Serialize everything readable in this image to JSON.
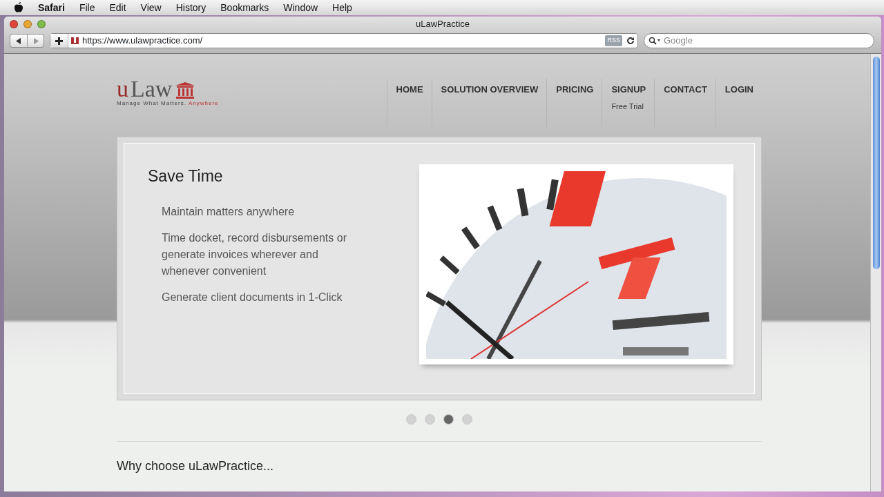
{
  "menu_bar": {
    "app": "Safari",
    "items": [
      "File",
      "Edit",
      "View",
      "History",
      "Bookmarks",
      "Window",
      "Help"
    ]
  },
  "window": {
    "title": "uLawPractice"
  },
  "toolbar": {
    "url": "https://www.ulawpractice.com/",
    "rss": "RSS",
    "search_placeholder": "Google"
  },
  "site": {
    "logo": {
      "word_u": "u",
      "word_rest": "Law",
      "tagline": "Manage What Matters.",
      "tagline_accent": "Anywhere"
    },
    "nav": [
      {
        "label": "HOME"
      },
      {
        "label": "SOLUTION OVERVIEW"
      },
      {
        "label": "PRICING"
      },
      {
        "label": "SIGNUP",
        "sub": "Free Trial"
      },
      {
        "label": "CONTACT"
      },
      {
        "label": "LOGIN"
      }
    ],
    "slide": {
      "title": "Save Time",
      "points": [
        "Maintain matters anywhere",
        "Time docket, record disbursements or generate invoices wherever and whenever convenient",
        "Generate client documents in 1-Click"
      ]
    },
    "dots": [
      {
        "selected": false
      },
      {
        "selected": false
      },
      {
        "selected": true
      },
      {
        "selected": false
      }
    ],
    "section_heading": "Why choose uLawPractice..."
  }
}
